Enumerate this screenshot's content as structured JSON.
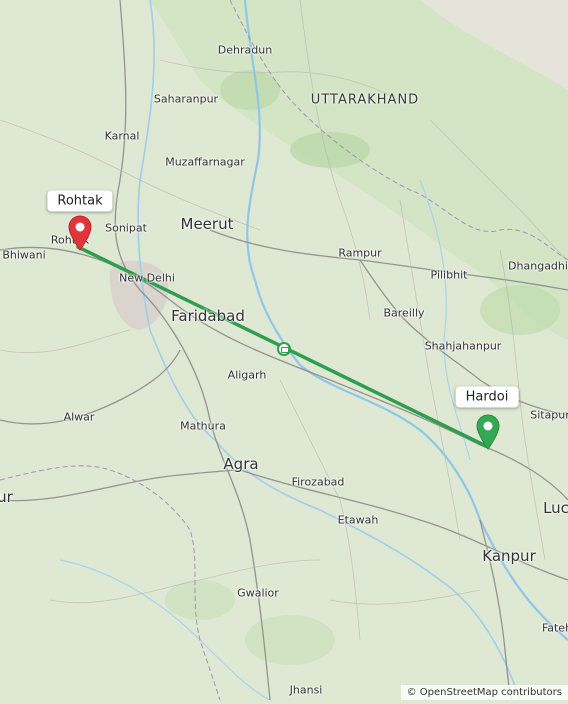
{
  "map": {
    "provider": "OpenStreetMap",
    "route_color": "#2e9e4f",
    "origin_marker_color": "#e0353a",
    "destination_marker_color": "#35a853",
    "origin": {
      "label": "Rohtak"
    },
    "destination": {
      "label": "Hardoi"
    }
  },
  "places": {
    "dehradun": "Dehradun",
    "uttarakhand": "UTTARAKHAND",
    "saharanpur": "Saharanpur",
    "karnal": "Karnal",
    "muzaffarnagar": "Muzaffarnagar",
    "sonipat": "Sonipat",
    "meerut": "Meerut",
    "rampur": "Rampur",
    "pilibhit": "Pilibhit",
    "dhangadhi": "Dhangadhi",
    "bhiwani": "Bhiwani",
    "rohtak_city": "Rohtak",
    "new_delhi": "New Delhi",
    "faridabad": "Faridabad",
    "bareilly": "Bareilly",
    "shahjahanpur": "Shahjahanpur",
    "aligarh": "Aligarh",
    "alwar": "Alwar",
    "mathura": "Mathura",
    "sitapur": "Sitapur",
    "agra": "Agra",
    "firozabad": "Firozabad",
    "etawah": "Etawah",
    "kanpur": "Kanpur",
    "lucknow_partial": "Luc",
    "gwalior": "Gwalior",
    "jhansi": "Jhansi",
    "fatehpur_partial": "Fateh",
    "left_partial": "ur"
  },
  "attribution": "© OpenStreetMap contributors"
}
